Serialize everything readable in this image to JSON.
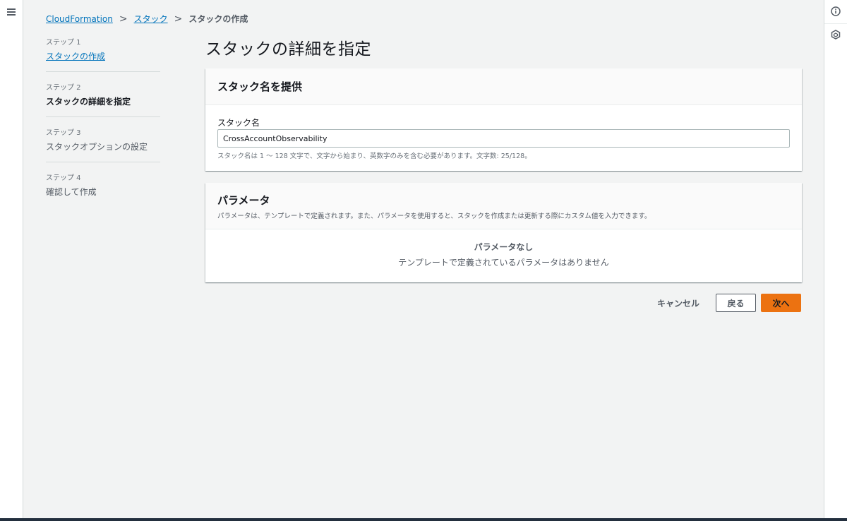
{
  "breadcrumb": {
    "items": [
      "CloudFormation",
      "スタック"
    ],
    "current": "スタックの作成",
    "separator": ">"
  },
  "steps": [
    {
      "label": "ステップ 1",
      "title": "スタックの作成"
    },
    {
      "label": "ステップ 2",
      "title": "スタックの詳細を指定"
    },
    {
      "label": "ステップ 3",
      "title": "スタックオプションの設定"
    },
    {
      "label": "ステップ 4",
      "title": "確認して作成"
    }
  ],
  "page_title": "スタックの詳細を指定",
  "stack_name_panel": {
    "title": "スタック名を提供",
    "field_label": "スタック名",
    "field_value": "CrossAccountObservability",
    "hint": "スタック名は 1 〜 128 文字で、文字から始まり、英数字のみを含む必要があります。文字数: 25/128。"
  },
  "parameters_panel": {
    "title": "パラメータ",
    "description": "パラメータは、テンプレートで定義されます。また、パラメータを使用すると、スタックを作成または更新する際にカスタム値を入力できます。",
    "empty_title": "パラメータなし",
    "empty_description": "テンプレートで定義されているパラメータはありません"
  },
  "actions": {
    "cancel": "キャンセル",
    "back": "戻る",
    "next": "次へ"
  },
  "icons": {
    "menu": "hamburger-icon",
    "info": "info-icon",
    "settings": "hexagon-icon"
  },
  "colors": {
    "link": "#0073bb",
    "primary": "#ec7211",
    "background": "#f2f3f3"
  }
}
